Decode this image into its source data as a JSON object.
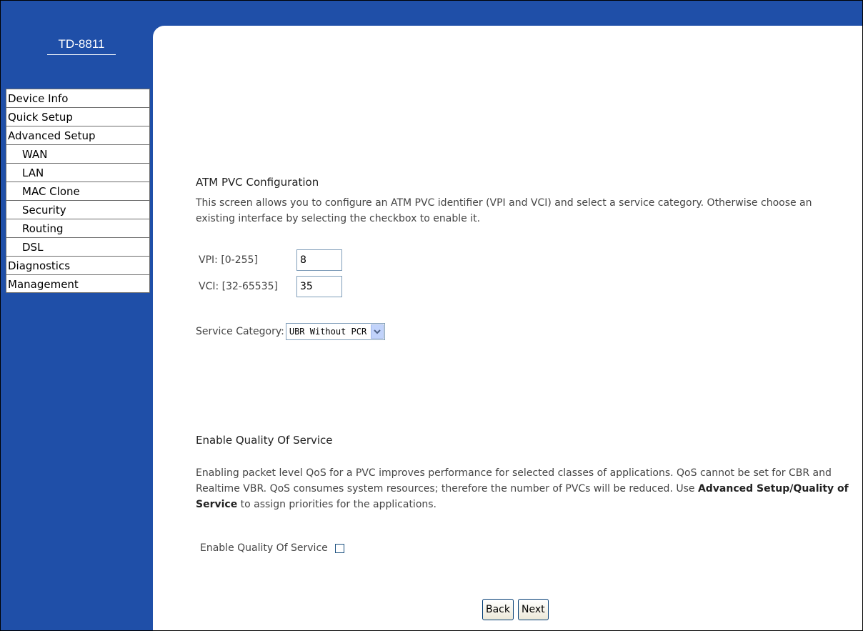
{
  "sidebar": {
    "logo": "TD-8811",
    "items": [
      {
        "label": "Device Info"
      },
      {
        "label": "Quick Setup"
      },
      {
        "label": "Advanced Setup"
      },
      {
        "label": "WAN"
      },
      {
        "label": "LAN"
      },
      {
        "label": "MAC Clone"
      },
      {
        "label": "Security"
      },
      {
        "label": "Routing"
      },
      {
        "label": "DSL"
      },
      {
        "label": "Diagnostics"
      },
      {
        "label": "Management"
      }
    ]
  },
  "atm": {
    "title": "ATM PVC Configuration",
    "description": "This screen allows you to configure an ATM PVC identifier (VPI and VCI) and select a service category. Otherwise choose an existing interface by selecting the checkbox to enable it.",
    "vpi_label": "VPI: [0-255]",
    "vpi_value": "8",
    "vci_label": "VCI: [32-65535]",
    "vci_value": "35",
    "service_label": "Service Category:",
    "service_value": "UBR Without PCR"
  },
  "qos": {
    "title": "Enable Quality Of Service",
    "desc_part1": "Enabling packet level QoS for a PVC improves performance for selected classes of applications.  QoS cannot be set for CBR and Realtime VBR.  QoS consumes system resources; therefore the number of PVCs will be reduced. Use ",
    "desc_bold": "Advanced Setup/Quality of Service",
    "desc_part2": " to assign priorities for the applications.",
    "checkbox_label": "Enable Quality Of Service",
    "checked": false
  },
  "buttons": {
    "back": "Back",
    "next": "Next"
  }
}
